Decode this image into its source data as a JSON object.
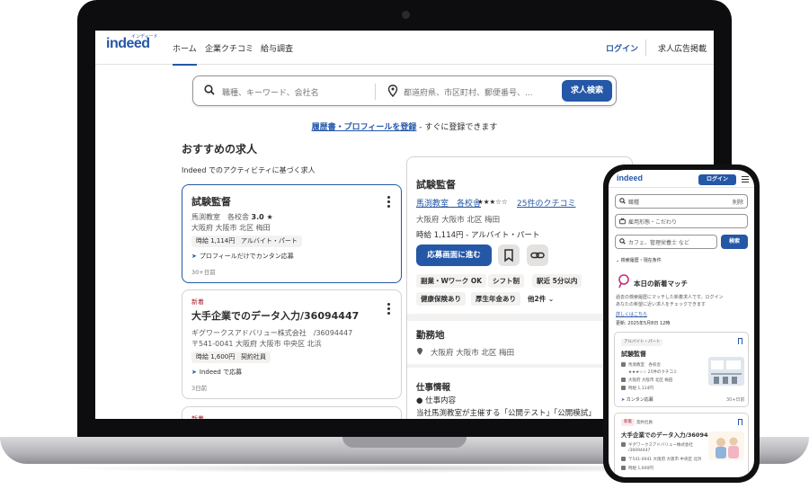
{
  "desktop": {
    "logo": "indeed",
    "logo_kana": "インディード",
    "nav": [
      "ホーム",
      "企業クチコミ",
      "給与調査"
    ],
    "login": "ログイン",
    "employer": "求人広告掲載",
    "search": {
      "what_placeholder": "職種、キーワード、会社名",
      "where_placeholder": "都道府県、市区町村、郵便番号、...",
      "button": "求人検索"
    },
    "resume_link": "履歴書・プロフィールを登録",
    "resume_suffix": " - すぐに登録できます",
    "recommended_title": "おすすめの求人",
    "recommended_sub": "Indeed でのアクティビティに基づく求人",
    "cards": [
      {
        "new": "",
        "title": "試験監督",
        "company": "馬渕教室　各校舎",
        "rating": "3.0 ★",
        "location": "大阪府 大阪市 北区 梅田",
        "tags": [
          "時給 1,114円",
          "アルバイト・パート"
        ],
        "apply": "プロフィールだけでカンタン応募",
        "date": "30+日前"
      },
      {
        "new": "新着",
        "title": "大手企業でのデータ入力/36094447",
        "company": "ギグワークスアドバリュー株式会社　/36094447",
        "location": "〒541-0041 大阪府 大阪市 中央区 北浜",
        "tags": [
          "時給 1,600円",
          "契約社員"
        ],
        "apply": "Indeed で応募",
        "date": "3日前"
      },
      {
        "new": "新着"
      }
    ],
    "detail": {
      "title": "試験監督",
      "company": "馬渕教室　各校舎",
      "stars": "★★★☆☆",
      "reviews": "25件のクチコミ",
      "location": "大阪府 大阪市 北区 梅田",
      "pay": "時給 1,114円 - アルバイト・パート",
      "apply": "応募画面に進む",
      "tags": [
        "副業・Wワーク OK",
        "シフト制",
        "駅近 5分以内",
        "健康保険あり",
        "厚生年金あり"
      ],
      "more": "他2件 ⌄",
      "workplace_heading": "勤務地",
      "workplace": "大阪府 大阪市 北区 梅田",
      "jobinfo_heading": "仕事情報",
      "jobinfo_bullet": "● 仕事内容",
      "jobinfo_text": "当社馬渕教室が主催する「公開テスト」「公開模試」"
    }
  },
  "mobile": {
    "logo": "indeed",
    "login": "ログイン",
    "what": "職種",
    "clear": "削除",
    "where": "雇用形態・こだわり",
    "keyword": "カフェ、管理栄養士 など",
    "search": "検索",
    "filters": "検索履歴・現在条件",
    "match_title": "本日の新着マッチ",
    "match_text_1": "過去の検索履歴にマッチした新着求人です。ログイン",
    "match_text_2": "あなたの希望に近い求人をチェックできます",
    "match_link": "詳しくはこちら",
    "updated": "更新: 2025年5月8日 12時",
    "cards": [
      {
        "tag": "アルバイト・パート",
        "title": "試験監督",
        "lines": [
          "馬渕教室　各校舎",
          "★★★☆☆ 25件のクチコミ",
          "大阪府 大阪市 北区 梅田",
          "時給 1,114円"
        ],
        "apply": "カンタン応募",
        "date": "30+日前"
      },
      {
        "tag": "新着",
        "tag2": "契約社員",
        "title": "大手企業でのデータ入力/36094447",
        "lines": [
          "ギグワークスアドバリュー株式会社",
          "/36094447",
          "〒541-0041 大阪府 大阪市 中央区 北浜",
          "時給 1,600円"
        ]
      }
    ]
  },
  "colors": {
    "brand": "#2557a7",
    "new": "#a9252b"
  }
}
